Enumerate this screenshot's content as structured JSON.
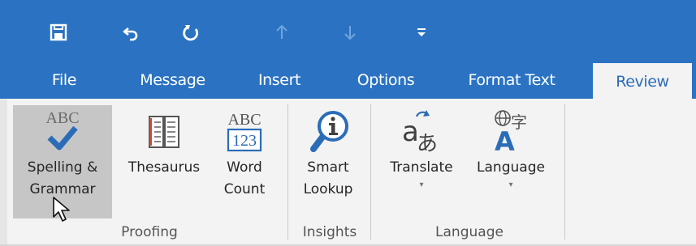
{
  "quick_access": {
    "icons": [
      "save-icon",
      "undo-icon",
      "redo-icon",
      "up-arrow-icon",
      "down-arrow-icon",
      "customize-toolbar-icon"
    ]
  },
  "tabs": [
    {
      "label": "File"
    },
    {
      "label": "Message"
    },
    {
      "label": "Insert"
    },
    {
      "label": "Options"
    },
    {
      "label": "Format Text"
    },
    {
      "label": "Review"
    }
  ],
  "active_tab": "Review",
  "ribbon": {
    "proofing": {
      "group_label": "Proofing",
      "spelling": {
        "line1": "Spelling &",
        "line2": "Grammar",
        "icon_text": "ABC"
      },
      "thesaurus": {
        "label": "Thesaurus"
      },
      "word_count": {
        "line1": "Word",
        "line2": "Count",
        "icon_top": "ABC",
        "icon_bottom": "123"
      }
    },
    "insights": {
      "group_label": "Insights",
      "smart_lookup": {
        "line1": "Smart",
        "line2": "Lookup"
      }
    },
    "language": {
      "group_label": "Language",
      "translate": {
        "label": "Translate",
        "dropdown": "▾"
      },
      "language": {
        "label": "Language",
        "dropdown": "▾"
      }
    }
  },
  "colors": {
    "title_bar": "#2b73c2",
    "ribbon_bg": "#f3f3f3",
    "selected_button": "#c6c6c6",
    "accent_blue": "#2b6cb7"
  }
}
